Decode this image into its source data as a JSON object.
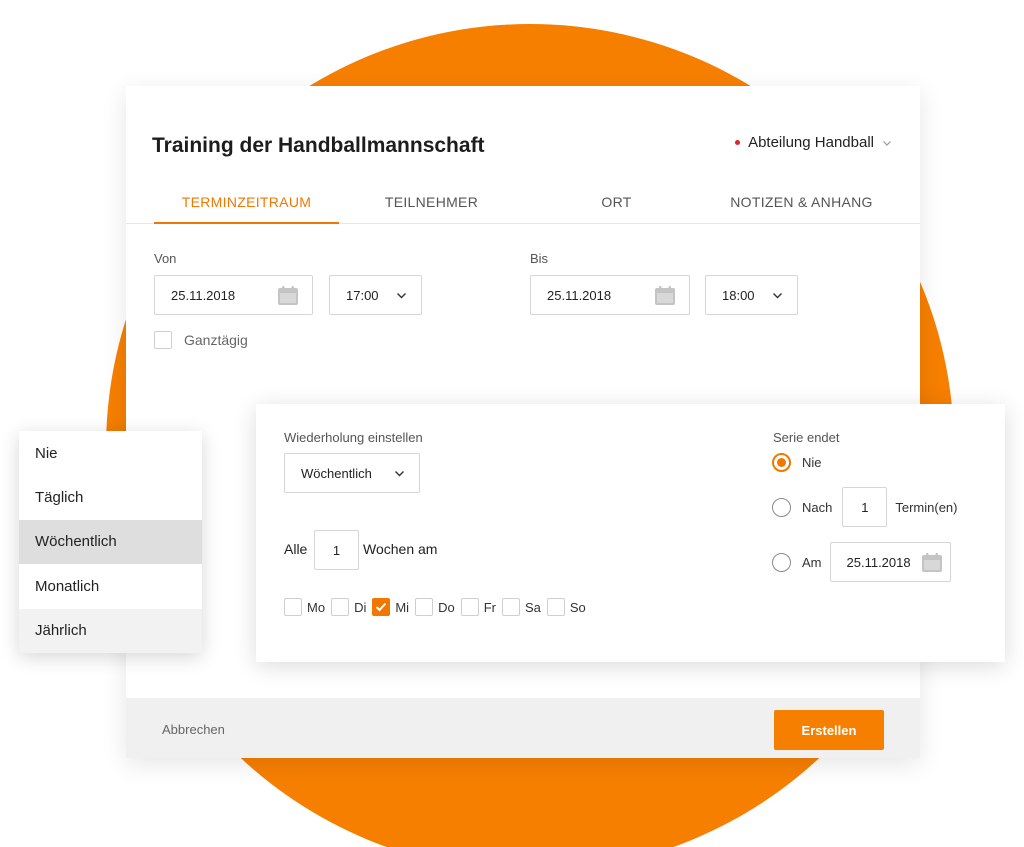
{
  "dialog": {
    "title": "Training der Handballmannschaft",
    "department": "Abteilung Handball",
    "tabs": [
      {
        "label": "TERMINZEITRAUM",
        "active": true
      },
      {
        "label": "TEILNEHMER",
        "active": false
      },
      {
        "label": "ORT",
        "active": false
      },
      {
        "label": "NOTIZEN & ANHANG",
        "active": false
      }
    ],
    "from_label": "Von",
    "from_date": "25.11.2018",
    "from_time": "17:00",
    "to_label": "Bis",
    "to_date": "25.11.2018",
    "to_time": "18:00",
    "allday_label": "Ganztägig",
    "cancel_label": "Abbrechen",
    "create_label": "Erstellen"
  },
  "recurrence": {
    "label": "Wiederholung einstellen",
    "selected": "Wöchentlich",
    "every_prefix": "Alle",
    "every_value": "1",
    "every_suffix": "Wochen am",
    "days": [
      {
        "label": "Mo",
        "checked": false
      },
      {
        "label": "Di",
        "checked": false
      },
      {
        "label": "Mi",
        "checked": true
      },
      {
        "label": "Do",
        "checked": false
      },
      {
        "label": "Fr",
        "checked": false
      },
      {
        "label": "Sa",
        "checked": false
      },
      {
        "label": "So",
        "checked": false
      }
    ],
    "series_end_label": "Serie endet",
    "end_never": "Nie",
    "end_after": "Nach",
    "end_after_value": "1",
    "end_after_unit": "Termin(en)",
    "end_on": "Am",
    "end_on_date": "25.11.2018"
  },
  "dropdown": {
    "options": [
      "Nie",
      "Täglich",
      "Wöchentlich",
      "Monatlich",
      "Jährlich"
    ],
    "selected_index": 2,
    "hover_index": 4
  },
  "colors": {
    "accent": "#f77f00",
    "dot": "#e0262f"
  },
  "icons": [
    "calendar-icon",
    "chevron-down-icon",
    "check-icon"
  ]
}
